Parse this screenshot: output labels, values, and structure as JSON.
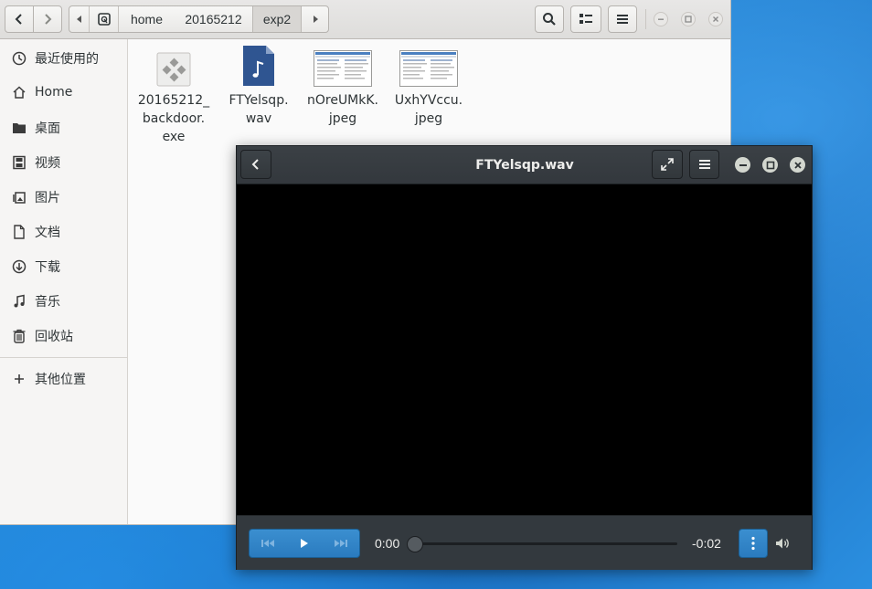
{
  "file_manager": {
    "nav": {
      "back": "‹",
      "forward": "›"
    },
    "breadcrumb": [
      {
        "label": "home"
      },
      {
        "label": "20165212"
      },
      {
        "label": "exp2"
      }
    ],
    "sidebar": [
      {
        "label": "最近使用的",
        "icon": "clock-icon"
      },
      {
        "label": "Home",
        "icon": "home-icon"
      },
      {
        "label": "桌面",
        "icon": "folder-icon"
      },
      {
        "label": "视频",
        "icon": "film-icon"
      },
      {
        "label": "图片",
        "icon": "picture-icon"
      },
      {
        "label": "文档",
        "icon": "document-icon"
      },
      {
        "label": "下载",
        "icon": "download-icon"
      },
      {
        "label": "音乐",
        "icon": "music-icon"
      },
      {
        "label": "回收站",
        "icon": "trash-icon"
      },
      {
        "label": "其他位置",
        "icon": "plus-icon"
      }
    ],
    "files": [
      {
        "name": "20165212_\nbackdoor.\nexe",
        "icon": "executable-icon"
      },
      {
        "name": "FTYelsqp.\nwav",
        "icon": "audio-file-icon"
      },
      {
        "name": "nOreUMkK.\njpeg",
        "icon": "image-thumbnail"
      },
      {
        "name": "UxhYVccu.\njpeg",
        "icon": "image-thumbnail"
      }
    ]
  },
  "video_player": {
    "title": "FTYelsqp.wav",
    "time_elapsed": "0:00",
    "time_remaining": "-0:02",
    "progress": 0
  },
  "colors": {
    "accent": "#2a7bbf",
    "desktop": "#1f7fcf",
    "player_header": "#373c41"
  }
}
